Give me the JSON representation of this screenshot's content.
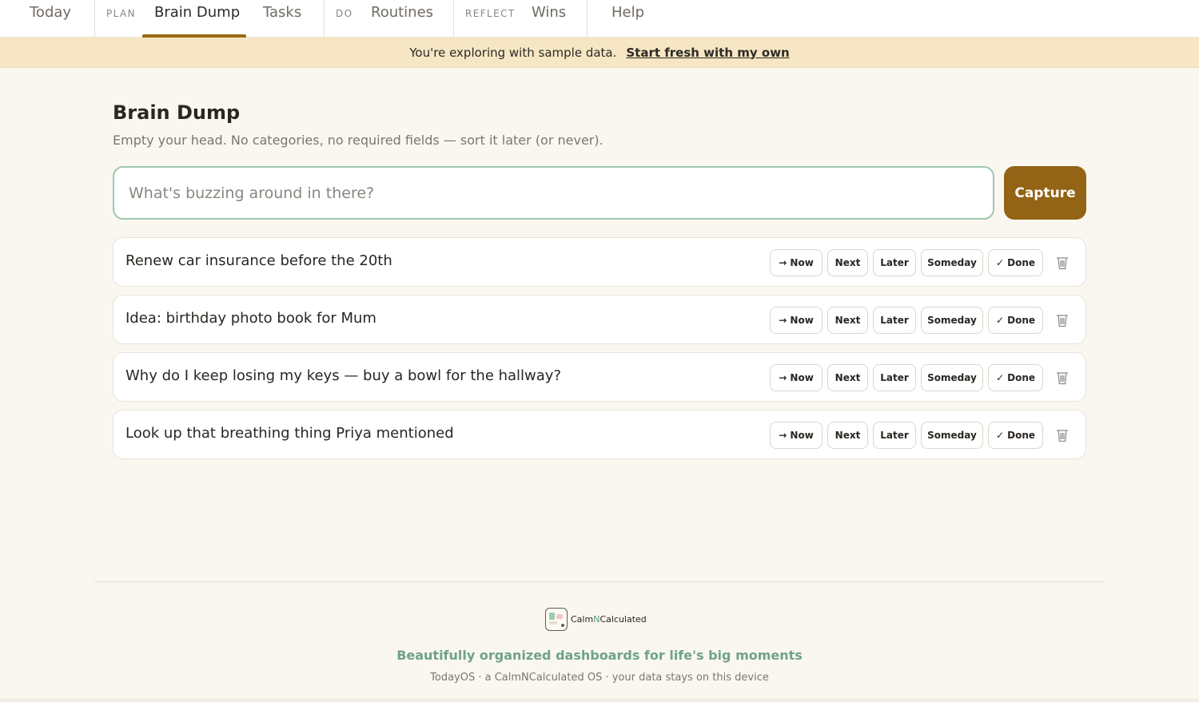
{
  "nav": {
    "today": "Today",
    "plan_label": "PLAN",
    "brain_dump": "Brain Dump",
    "tasks": "Tasks",
    "do_label": "DO",
    "routines": "Routines",
    "reflect_label": "REFLECT",
    "wins": "Wins",
    "help": "Help",
    "active_tab": "Brain Dump"
  },
  "banner": {
    "message": "You're exploring with sample data.",
    "link": "Start fresh with my own"
  },
  "page": {
    "title": "Brain Dump",
    "subtitle": "Empty your head. No categories, no required fields — sort it later (or never)."
  },
  "capture": {
    "placeholder": "What's buzzing around in there?",
    "value": "",
    "button_label": "Capture"
  },
  "actions": {
    "now": "→ Now",
    "next": "Next",
    "later": "Later",
    "someday": "Someday",
    "done": "✓ Done",
    "delete_icon": "trash-icon"
  },
  "items": [
    {
      "text": "Renew car insurance before the 20th"
    },
    {
      "text": "Idea: birthday photo book for Mum"
    },
    {
      "text": "Why do I keep losing my keys — buy a bowl for the hallway?"
    },
    {
      "text": "Look up that breathing thing Priya mentioned"
    }
  ],
  "footer": {
    "brand_part1": "Calm",
    "brand_part2": "N",
    "brand_part3": "Calculated",
    "tagline": "Beautifully organized dashboards for life's big moments",
    "note": "TodayOS · a CalmNCalculated OS · your data stays on this device"
  },
  "colors": {
    "accent": "#936415",
    "tab_underline": "#9a6a12",
    "banner_bg": "#f6e6c4",
    "input_border": "#9ec7b1",
    "tagline": "#6ea387",
    "page_bg": "#faf6f0"
  }
}
